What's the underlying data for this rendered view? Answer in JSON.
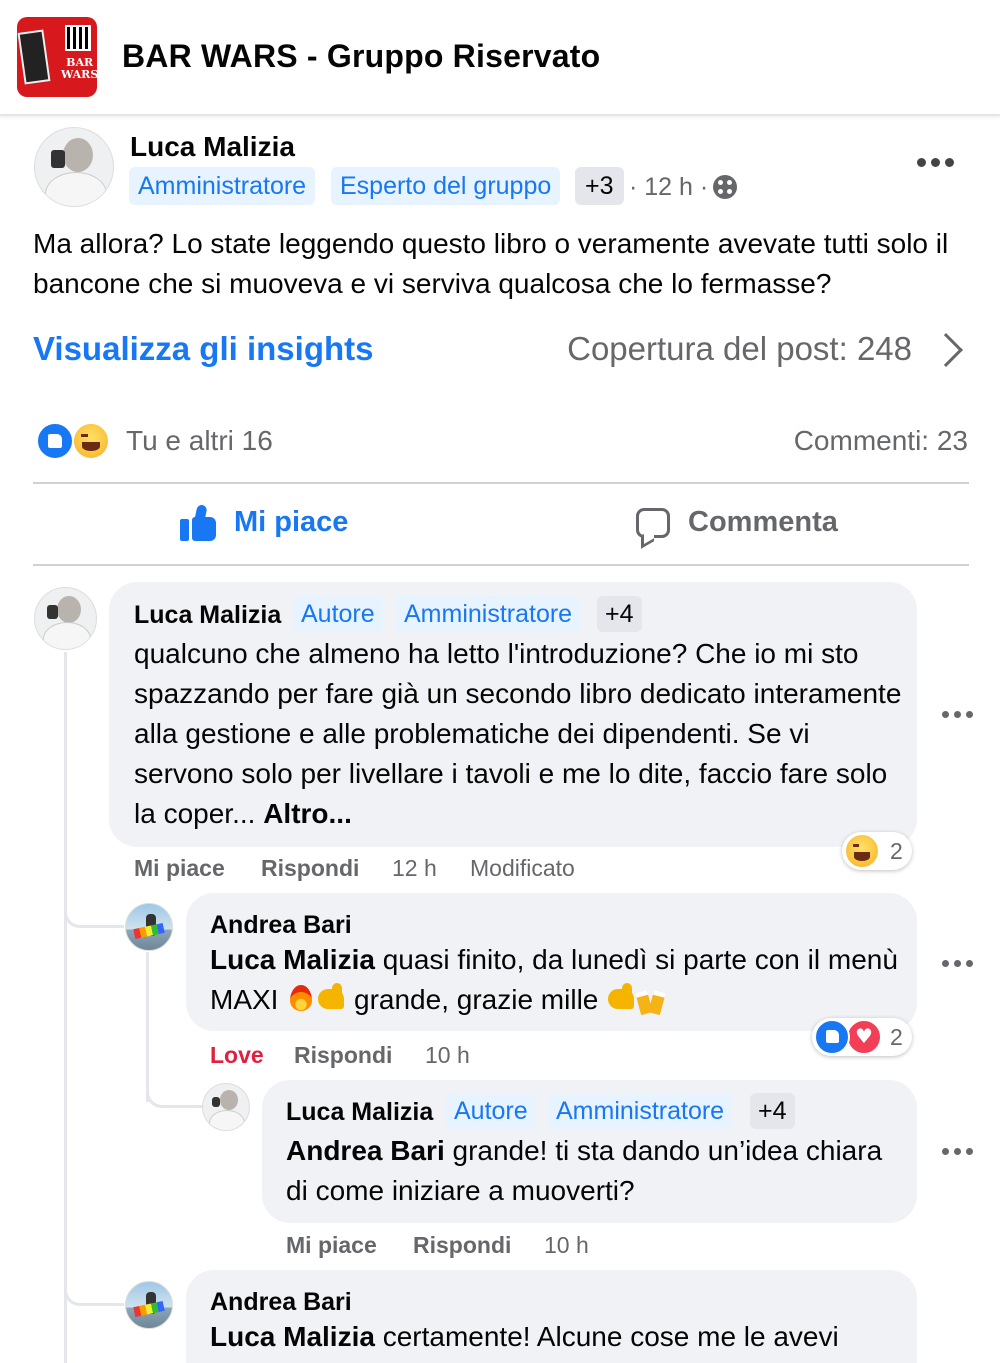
{
  "header": {
    "group_title": "BAR WARS - Gruppo Riservato",
    "thumb_text": "BAR WARS"
  },
  "post": {
    "author": "Luca Malizia",
    "badges": [
      "Amministratore",
      "Esperto del gruppo"
    ],
    "badge_more": "+3",
    "time": "· 12 h ·",
    "text": "Ma allora? Lo state leggendo questo libro o veramente avevate tutti solo il bancone che si muoveva e vi serviva qualcosa che lo fermasse?",
    "insights_link": "Visualizza gli insights",
    "reach": "Copertura del post: 248",
    "reactors": "Tu e altri 16",
    "comments_count": "Commenti: 23",
    "like_action": "Mi piace",
    "comment_action": "Commenta"
  },
  "comments": [
    {
      "author": "Luca Malizia",
      "badges": [
        "Autore",
        "Amministratore"
      ],
      "badge_more": "+4",
      "text": "qualcuno che almeno ha letto l'introduzione? Che io mi sto spazzando per fare già un secondo libro dedicato interamente alla gestione e alle problematiche dei dipendenti. Se vi servono solo per livellare i tavoli e me lo dite, faccio fare solo la coper...",
      "more": "Altro...",
      "actions": {
        "like": "Mi piace",
        "reply": "Rispondi",
        "time": "12 h",
        "edited": "Modificato"
      },
      "reaction_count": "2"
    },
    {
      "author": "Andrea Bari",
      "mention": "Luca Malizia",
      "text_1": " quasi finito, da lunedì si parte con il menù MAXI ",
      "text_2": " grande, grazie mille ",
      "actions": {
        "love": "Love",
        "reply": "Rispondi",
        "time": "10 h"
      },
      "reaction_count": "2"
    },
    {
      "author": "Luca Malizia",
      "badges": [
        "Autore",
        "Amministratore"
      ],
      "badge_more": "+4",
      "mention": "Andrea Bari",
      "text": " grande! ti sta dando un’idea chiara di come iniziare a muoverti?",
      "actions": {
        "like": "Mi piace",
        "reply": "Rispondi",
        "time": "10 h"
      }
    },
    {
      "author": "Andrea Bari",
      "mention": "Luca Malizia",
      "text": " certamente! Alcune cose me le avevi"
    }
  ],
  "icons": {
    "like_color": "#1877f2",
    "love_color": "#f33e58",
    "haha_color": "#f7b125"
  }
}
